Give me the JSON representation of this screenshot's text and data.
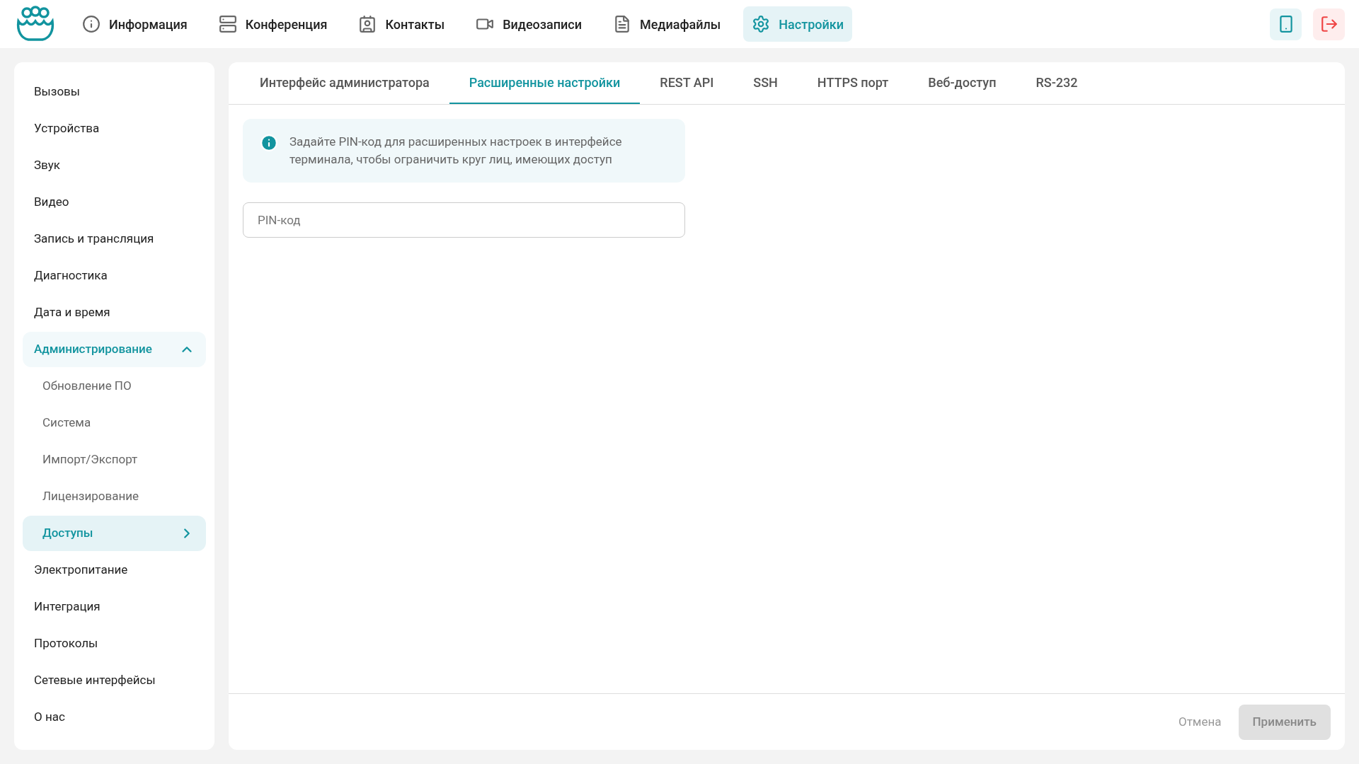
{
  "nav": [
    {
      "label": "Информация",
      "kind": "info",
      "selected": false
    },
    {
      "label": "Конференция",
      "kind": "conference",
      "selected": false
    },
    {
      "label": "Контакты",
      "kind": "contacts",
      "selected": false
    },
    {
      "label": "Видеозаписи",
      "kind": "video",
      "selected": false
    },
    {
      "label": "Медиафайлы",
      "kind": "media",
      "selected": false
    },
    {
      "label": "Настройки",
      "kind": "settings",
      "selected": true
    }
  ],
  "sidebar": {
    "items": [
      {
        "label": "Вызовы",
        "selected": false
      },
      {
        "label": "Устройства",
        "selected": false
      },
      {
        "label": "Звук",
        "selected": false
      },
      {
        "label": "Видео",
        "selected": false
      },
      {
        "label": "Запись и трансляция",
        "selected": false
      },
      {
        "label": "Диагностика",
        "selected": false
      },
      {
        "label": "Дата и время",
        "selected": false
      },
      {
        "label": "Администрирование",
        "selected": false,
        "expanded": true,
        "children": [
          {
            "label": "Обновление ПО",
            "selected": false
          },
          {
            "label": "Система",
            "selected": false
          },
          {
            "label": "Импорт/Экспорт",
            "selected": false
          },
          {
            "label": "Лицензирование",
            "selected": false
          },
          {
            "label": "Доступы",
            "selected": true
          }
        ]
      },
      {
        "label": "Электропитание",
        "selected": false
      },
      {
        "label": "Интеграция",
        "selected": false
      },
      {
        "label": "Протоколы",
        "selected": false
      },
      {
        "label": "Сетевые интерфейсы",
        "selected": false
      },
      {
        "label": "О нас",
        "selected": false
      }
    ]
  },
  "tabs": [
    {
      "label": "Интерфейс администратора",
      "selected": false
    },
    {
      "label": "Расширенные настройки",
      "selected": true
    },
    {
      "label": "REST API",
      "selected": false
    },
    {
      "label": "SSH",
      "selected": false
    },
    {
      "label": "HTTPS порт",
      "selected": false
    },
    {
      "label": "Веб-доступ",
      "selected": false
    },
    {
      "label": "RS-232",
      "selected": false
    }
  ],
  "info": {
    "text": "Задайте PIN-код для расширенных настроек в интерфейсе терминала, чтобы ограничить круг лиц, имеющих доступ"
  },
  "pin_field": {
    "placeholder": "PIN-код"
  },
  "footer": {
    "cancel": {
      "label": "Отмена",
      "disabled": true
    },
    "apply": {
      "label": "Применить",
      "disabled": true
    }
  }
}
